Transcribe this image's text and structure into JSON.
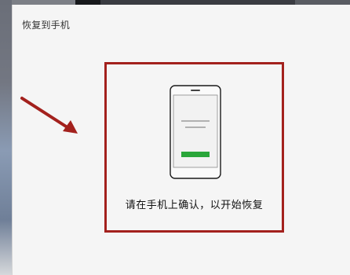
{
  "window": {
    "title": "恢复到手机"
  },
  "restore_prompt": {
    "message": "请在手机上确认，以开始恢复"
  },
  "colors": {
    "highlight_border": "#a3211d",
    "arrow": "#a3211d",
    "phone_button": "#2aa63a"
  },
  "icons": {
    "phone": "phone-icon",
    "arrow": "arrow-annotation-icon"
  }
}
